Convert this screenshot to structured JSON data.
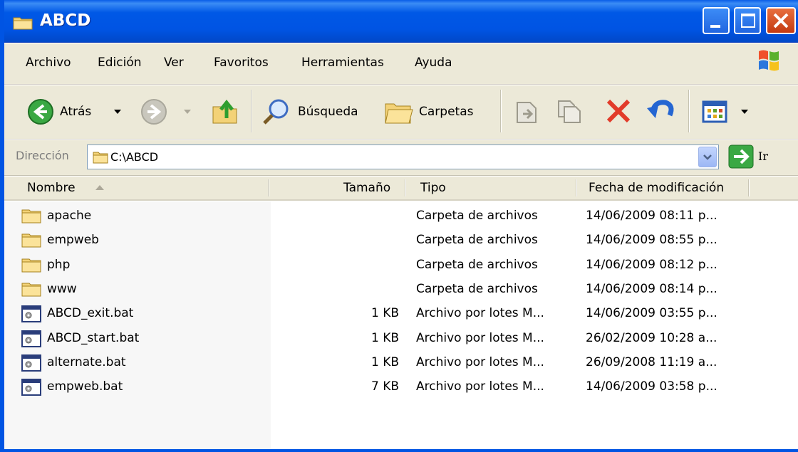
{
  "window": {
    "title": "ABCD"
  },
  "menu": [
    "Archivo",
    "Edición",
    "Ver",
    "Favoritos",
    "Herramientas",
    "Ayuda"
  ],
  "toolbar": {
    "back_label": "Atrás",
    "search_label": "Búsqueda",
    "folders_label": "Carpetas"
  },
  "address": {
    "label": "Dirección",
    "value": "C:\\ABCD",
    "go_label": "Ir"
  },
  "columns": [
    "Nombre",
    "Tamaño",
    "Tipo",
    "Fecha de modificación"
  ],
  "files": [
    {
      "name": "apache",
      "size": "",
      "type": "Carpeta de archivos",
      "date": "14/06/2009 08:11 p...",
      "icon": "folder-icon"
    },
    {
      "name": "empweb",
      "size": "",
      "type": "Carpeta de archivos",
      "date": "14/06/2009 08:55 p...",
      "icon": "folder-icon"
    },
    {
      "name": "php",
      "size": "",
      "type": "Carpeta de archivos",
      "date": "14/06/2009 08:12 p...",
      "icon": "folder-icon"
    },
    {
      "name": "www",
      "size": "",
      "type": "Carpeta de archivos",
      "date": "14/06/2009 08:14 p...",
      "icon": "folder-icon"
    },
    {
      "name": "ABCD_exit.bat",
      "size": "1 KB",
      "type": "Archivo por lotes M...",
      "date": "14/06/2009 03:55 p...",
      "icon": "batch-file-icon"
    },
    {
      "name": "ABCD_start.bat",
      "size": "1 KB",
      "type": "Archivo por lotes M...",
      "date": "26/02/2009 10:28 a...",
      "icon": "batch-file-icon"
    },
    {
      "name": "alternate.bat",
      "size": "1 KB",
      "type": "Archivo por lotes M...",
      "date": "26/09/2008 11:19 a...",
      "icon": "batch-file-icon"
    },
    {
      "name": "empweb.bat",
      "size": "7 KB",
      "type": "Archivo por lotes M...",
      "date": "14/06/2009 03:58 p...",
      "icon": "batch-file-icon"
    }
  ],
  "colors": {
    "titlebar": "#0054e3",
    "chrome": "#ece9d8",
    "close": "#c33a12"
  }
}
